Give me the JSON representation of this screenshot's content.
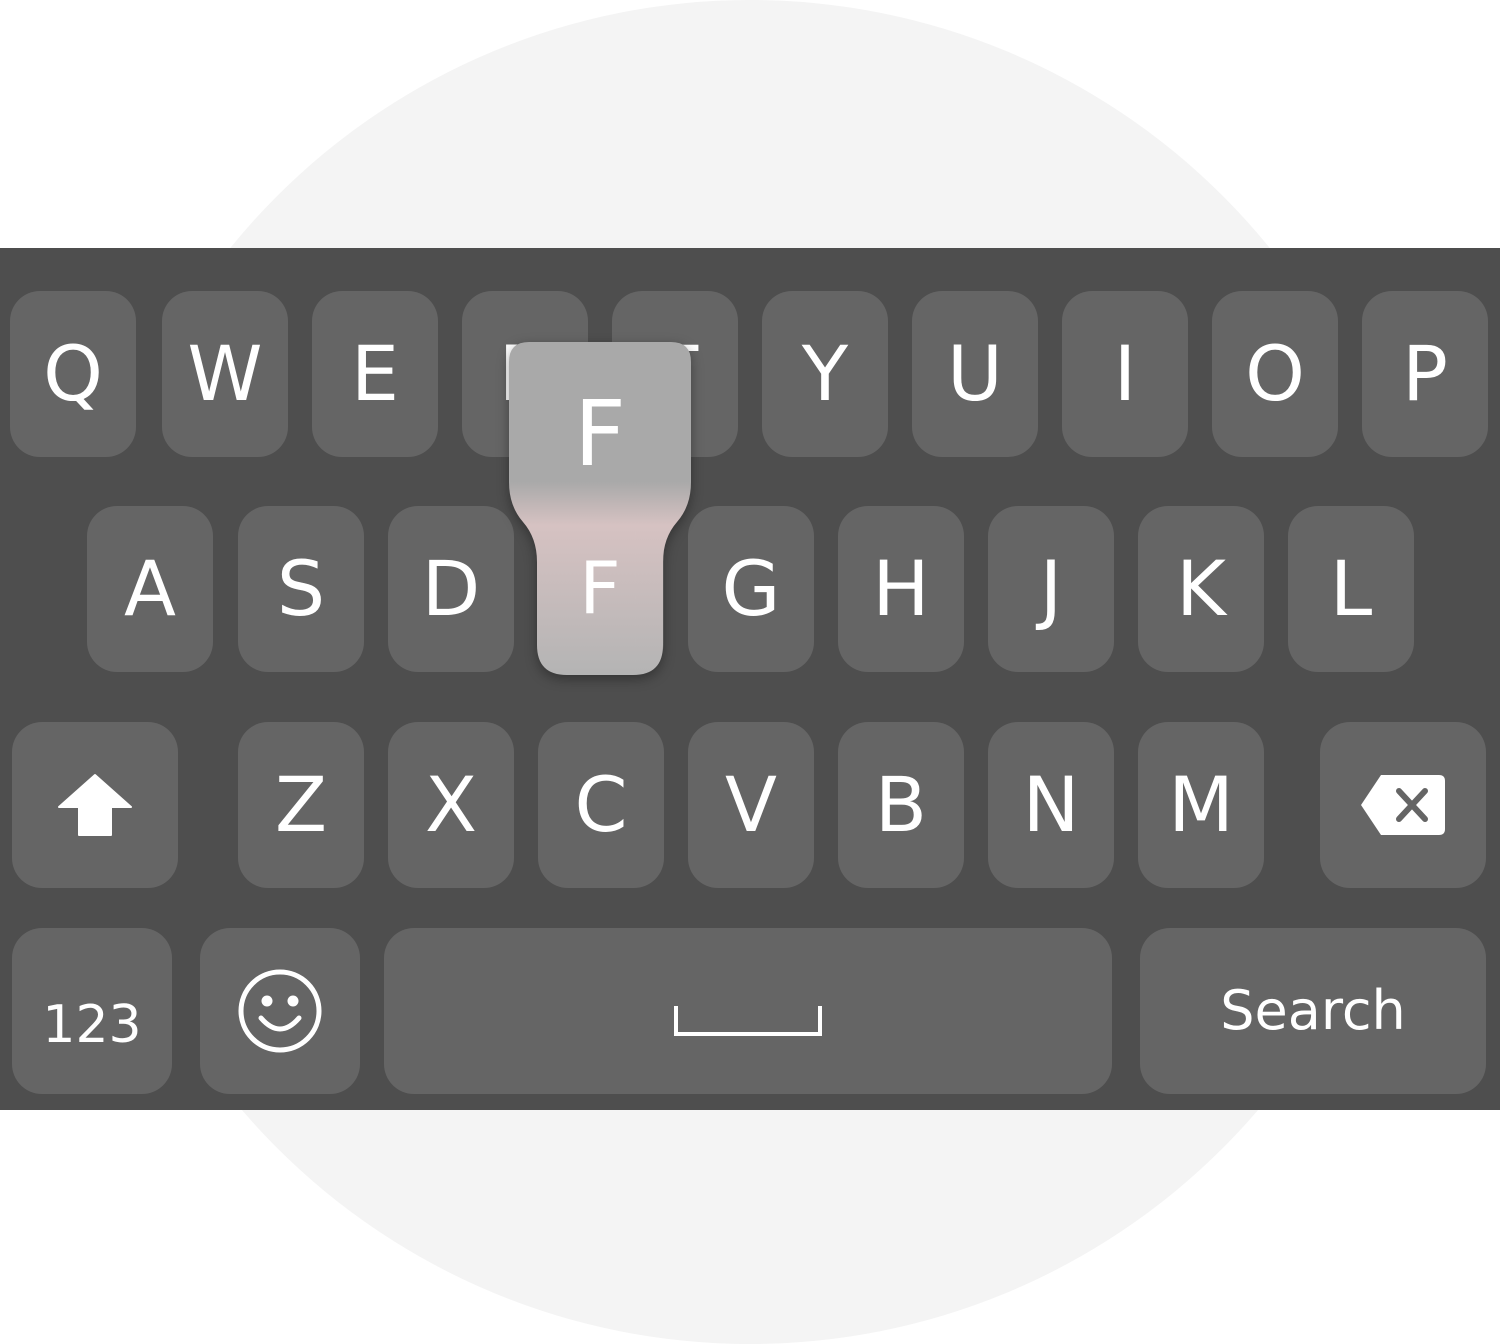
{
  "keyboard": {
    "colors": {
      "background": "#4e4e4e",
      "key": "#656565",
      "preview_top": "#a9a9a9",
      "preview_bottom": "#d6c2c2",
      "text": "#ffffff"
    },
    "row1": [
      "Q",
      "W",
      "E",
      "R",
      "T",
      "Y",
      "U",
      "I",
      "O",
      "P"
    ],
    "row2": [
      "A",
      "S",
      "D",
      "F",
      "G",
      "H",
      "J",
      "K",
      "L"
    ],
    "row3": [
      "Z",
      "X",
      "C",
      "V",
      "B",
      "N",
      "M"
    ],
    "shift_icon": "shift-arrow-icon",
    "backspace_icon": "backspace-icon",
    "numbers_label": "123",
    "emoji_icon": "smiley-icon",
    "space_icon": "space-bar-icon",
    "search_label": "Search",
    "pressed_key": "F",
    "preview": {
      "top_label": "F",
      "bottom_label": "F"
    }
  }
}
